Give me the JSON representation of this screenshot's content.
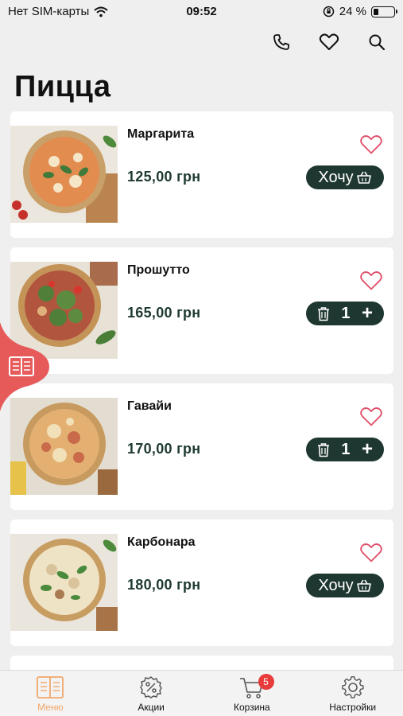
{
  "status_bar": {
    "carrier": "Нет SIM-карты",
    "time": "09:52",
    "battery_percent": "24 %",
    "battery_level": 0.24
  },
  "header": {
    "icons": [
      "phone-icon",
      "heart-icon",
      "search-icon"
    ]
  },
  "page": {
    "title": "Пицца"
  },
  "products": [
    {
      "name": "Маргарита",
      "price": "125,00 грн",
      "action": "want",
      "want_label": "Хочу"
    },
    {
      "name": "Прошутто",
      "price": "165,00 грн",
      "action": "stepper",
      "quantity": "1",
      "plus_label": "+"
    },
    {
      "name": "Гавайи",
      "price": "170,00 грн",
      "action": "stepper",
      "quantity": "1",
      "plus_label": "+"
    },
    {
      "name": "Карбонара",
      "price": "180,00 грн",
      "action": "want",
      "want_label": "Хочу"
    }
  ],
  "bottom_nav": {
    "items": [
      {
        "label": "Меню",
        "icon": "menu-book-icon",
        "active": true
      },
      {
        "label": "Акции",
        "icon": "discount-gear-icon",
        "active": false
      },
      {
        "label": "Корзина",
        "icon": "cart-icon",
        "active": false
      },
      {
        "label": "Настройки",
        "icon": "settings-gear-icon",
        "active": false
      }
    ],
    "cart_badge": "5"
  },
  "colors": {
    "accent_dark": "#1e3730",
    "price_text": "#1f3b30",
    "favorite_heart": "#e0506a",
    "side_tab": "#e75a5a",
    "active_nav": "#f2a76a",
    "badge": "#e83b3b"
  }
}
